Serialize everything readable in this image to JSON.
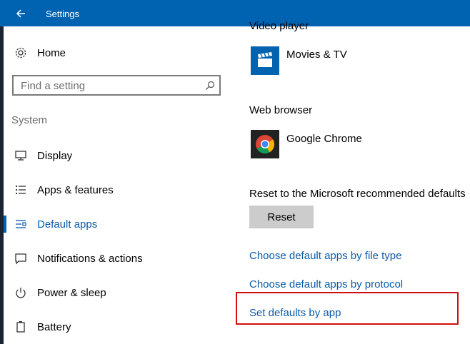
{
  "window": {
    "title": "Settings"
  },
  "sidebar": {
    "home_label": "Home",
    "search_placeholder": "Find a setting",
    "section_label": "System",
    "items": [
      {
        "label": "Display",
        "icon": "monitor-icon"
      },
      {
        "label": "Apps & features",
        "icon": "list-icon"
      },
      {
        "label": "Default apps",
        "icon": "default-apps-icon",
        "active": true
      },
      {
        "label": "Notifications & actions",
        "icon": "message-icon"
      },
      {
        "label": "Power & sleep",
        "icon": "power-icon"
      },
      {
        "label": "Battery",
        "icon": "battery-icon"
      }
    ]
  },
  "main": {
    "video_player": {
      "heading": "Video player",
      "app": "Movies & TV",
      "icon": "movies-tv-icon"
    },
    "web_browser": {
      "heading": "Web browser",
      "app": "Google Chrome",
      "icon": "chrome-icon"
    },
    "reset": {
      "heading": "Reset to the Microsoft recommended defaults",
      "button_label": "Reset"
    },
    "links": [
      "Choose default apps by file type",
      "Choose default apps by protocol",
      "Set defaults by app"
    ]
  },
  "colors": {
    "accent": "#0063b1",
    "link": "#0a5bab",
    "highlight": "#d00f0f"
  }
}
